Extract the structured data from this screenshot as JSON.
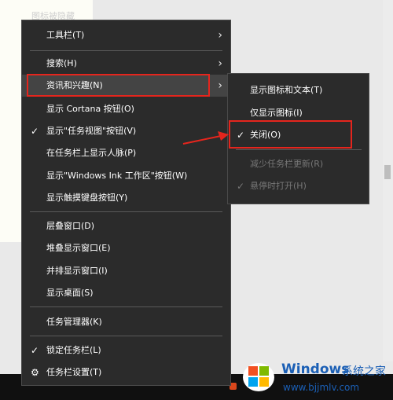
{
  "background": {
    "card_text": "图标被隐藏"
  },
  "context_menu": {
    "items": [
      {
        "label": "工具栏(T)",
        "submenu": true
      },
      {
        "label": "搜索(H)",
        "submenu": true
      },
      {
        "label": "资讯和兴趣(N)",
        "submenu": true,
        "highlighted": true
      },
      {
        "label": "显示 Cortana 按钮(O)"
      },
      {
        "label": "显示\"任务视图\"按钮(V)",
        "checked": true
      },
      {
        "label": "在任务栏上显示人脉(P)"
      },
      {
        "label": "显示\"Windows Ink 工作区\"按钮(W)"
      },
      {
        "label": "显示触摸键盘按钮(Y)"
      },
      {
        "label": "层叠窗口(D)"
      },
      {
        "label": "堆叠显示窗口(E)"
      },
      {
        "label": "并排显示窗口(I)"
      },
      {
        "label": "显示桌面(S)"
      },
      {
        "label": "任务管理器(K)"
      },
      {
        "label": "锁定任务栏(L)",
        "checked": true
      },
      {
        "label": "任务栏设置(T)",
        "icon": "gear-icon"
      }
    ]
  },
  "submenu": {
    "items": [
      {
        "label": "显示图标和文本(T)"
      },
      {
        "label": "仅显示图标(I)"
      },
      {
        "label": "关闭(O)",
        "checked": true
      },
      {
        "label": "减少任务栏更新(R)",
        "disabled": true
      },
      {
        "label": "悬停时打开(H)",
        "disabled": true,
        "checked": true
      }
    ]
  },
  "glyphs": {
    "check": "✓",
    "arrow": "›",
    "gear": "⚙"
  },
  "watermark": {
    "brand": "Windows",
    "brand_cn": "系统之家",
    "url": "www.bjjmlv.com"
  },
  "colors": {
    "menu_bg": "#2b2b2b",
    "highlight": "#444444",
    "annotation_red": "#e5251d",
    "watermark_blue": "#1b5fb5"
  }
}
